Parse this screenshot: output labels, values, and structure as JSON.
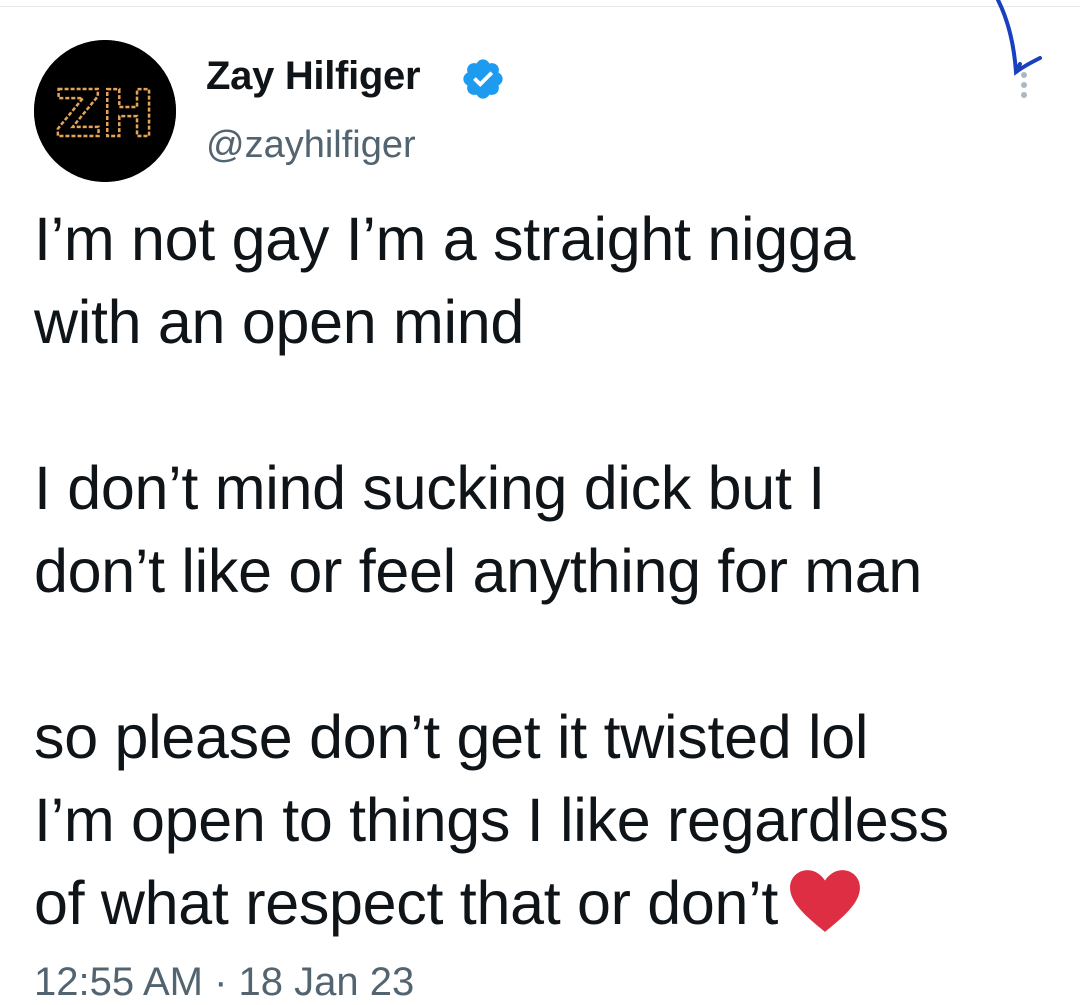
{
  "header": {
    "display_name": "Zay Hilfiger",
    "handle": "@zayhilfiger",
    "avatar_text": "ZH",
    "verified_icon": "verified-badge-icon",
    "more_icon": "more-vertical-icon"
  },
  "tweet": {
    "lines": [
      "I’m not gay I’m a straight nigga",
      "with an open mind",
      "I don’t mind sucking dick but I",
      "don’t like or feel anything for man",
      "so please don’t get it twisted lol",
      "I’m open to things I like regardless",
      "of what respect that or don’t"
    ],
    "emoji": "red-heart-icon",
    "timestamp": "12:55 AM · 18 Jan 23"
  },
  "colors": {
    "text": "#0f1419",
    "secondary": "#536471",
    "verified": "#1d9bf0",
    "heart": "#dd2e44",
    "avatar_bg": "#000000",
    "avatar_letter": "#e3a35a",
    "pen_mark": "#1a3fbf"
  }
}
